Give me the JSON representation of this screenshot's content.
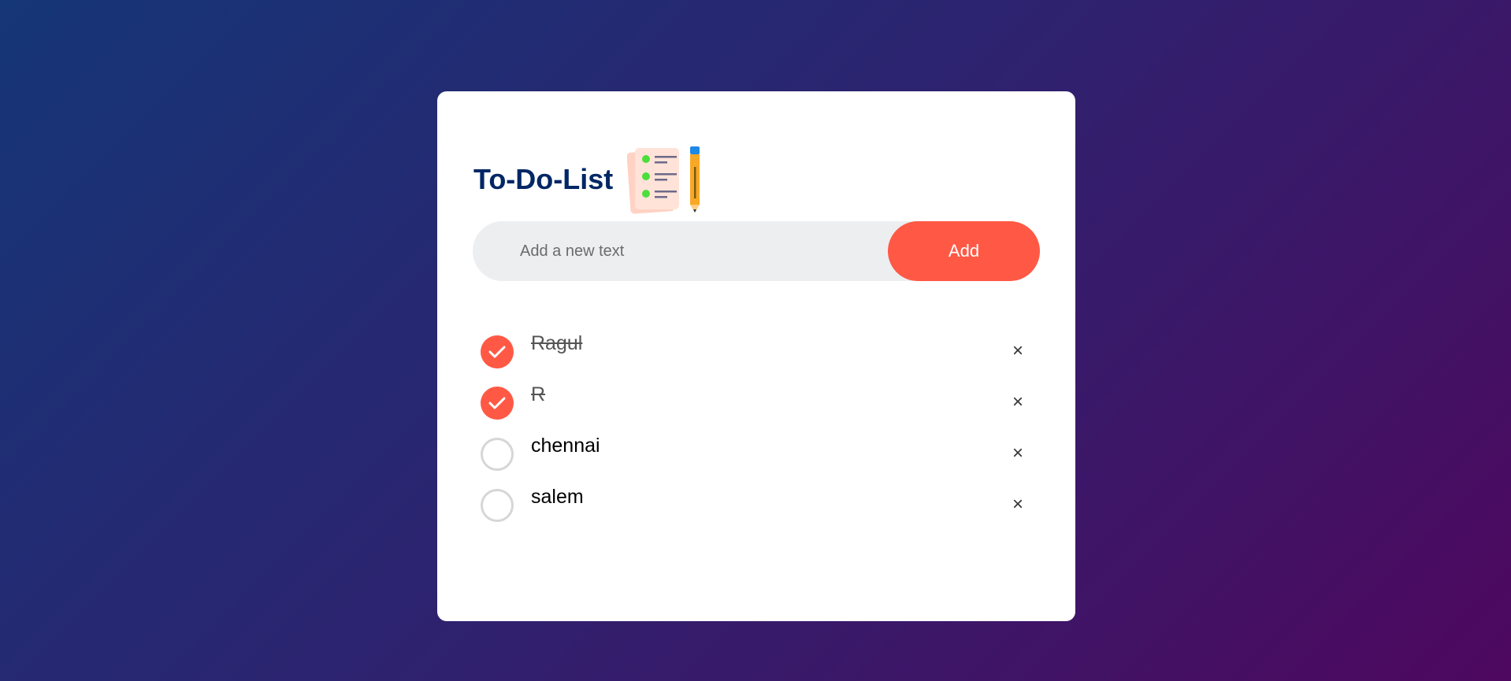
{
  "app": {
    "title": "To-Do-List",
    "title_icon": "checklist-with-pencil-icon"
  },
  "input": {
    "placeholder": "Add a new text",
    "value": "",
    "add_label": "Add"
  },
  "colors": {
    "accent": "#ff5945",
    "title": "#002765",
    "input_bg": "#edeef0",
    "bg_start": "#153677",
    "bg_end": "#4e085f"
  },
  "tasks": [
    {
      "text": "Ragul",
      "done": true,
      "delete_label": "×"
    },
    {
      "text": "R",
      "done": true,
      "delete_label": "×"
    },
    {
      "text": "chennai",
      "done": false,
      "delete_label": "×"
    },
    {
      "text": "salem",
      "done": false,
      "delete_label": "×"
    }
  ]
}
